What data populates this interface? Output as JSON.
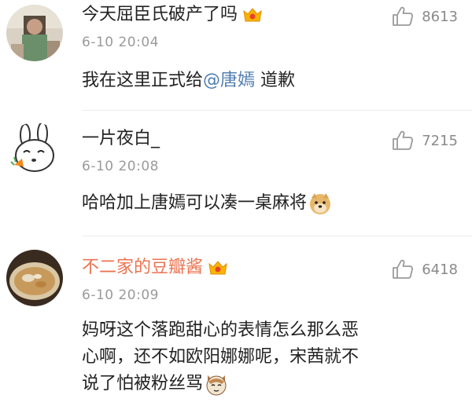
{
  "comments": [
    {
      "username": "今天屈臣氏破产了吗",
      "time": "6-10 20:04",
      "likes": "8613",
      "text_before": "我在这里正式给",
      "mention": "@唐嫣",
      "text_after": " 道歉"
    },
    {
      "username": "一片夜白_",
      "time": "6-10 20:08",
      "likes": "7215",
      "text": "哈哈加上唐嫣可以凑一桌麻将"
    },
    {
      "username": "不二家的豆瓣酱",
      "time": "6-10 20:09",
      "likes": "6418",
      "text_line1": "妈呀这个落跑甜心的表情怎么那么恶",
      "text_line2": "心啊，还不如欧阳娜娜呢，宋茜就不",
      "text_line3": "说了怕被粉丝骂"
    }
  ],
  "colors": {
    "username_vip": "#eb7350",
    "mention": "#507daf",
    "meta": "#9a9a9a"
  },
  "icons": [
    "vip-crown-icon",
    "thumbs-up-icon",
    "doge-emoji-icon",
    "cat-emoji-icon"
  ]
}
